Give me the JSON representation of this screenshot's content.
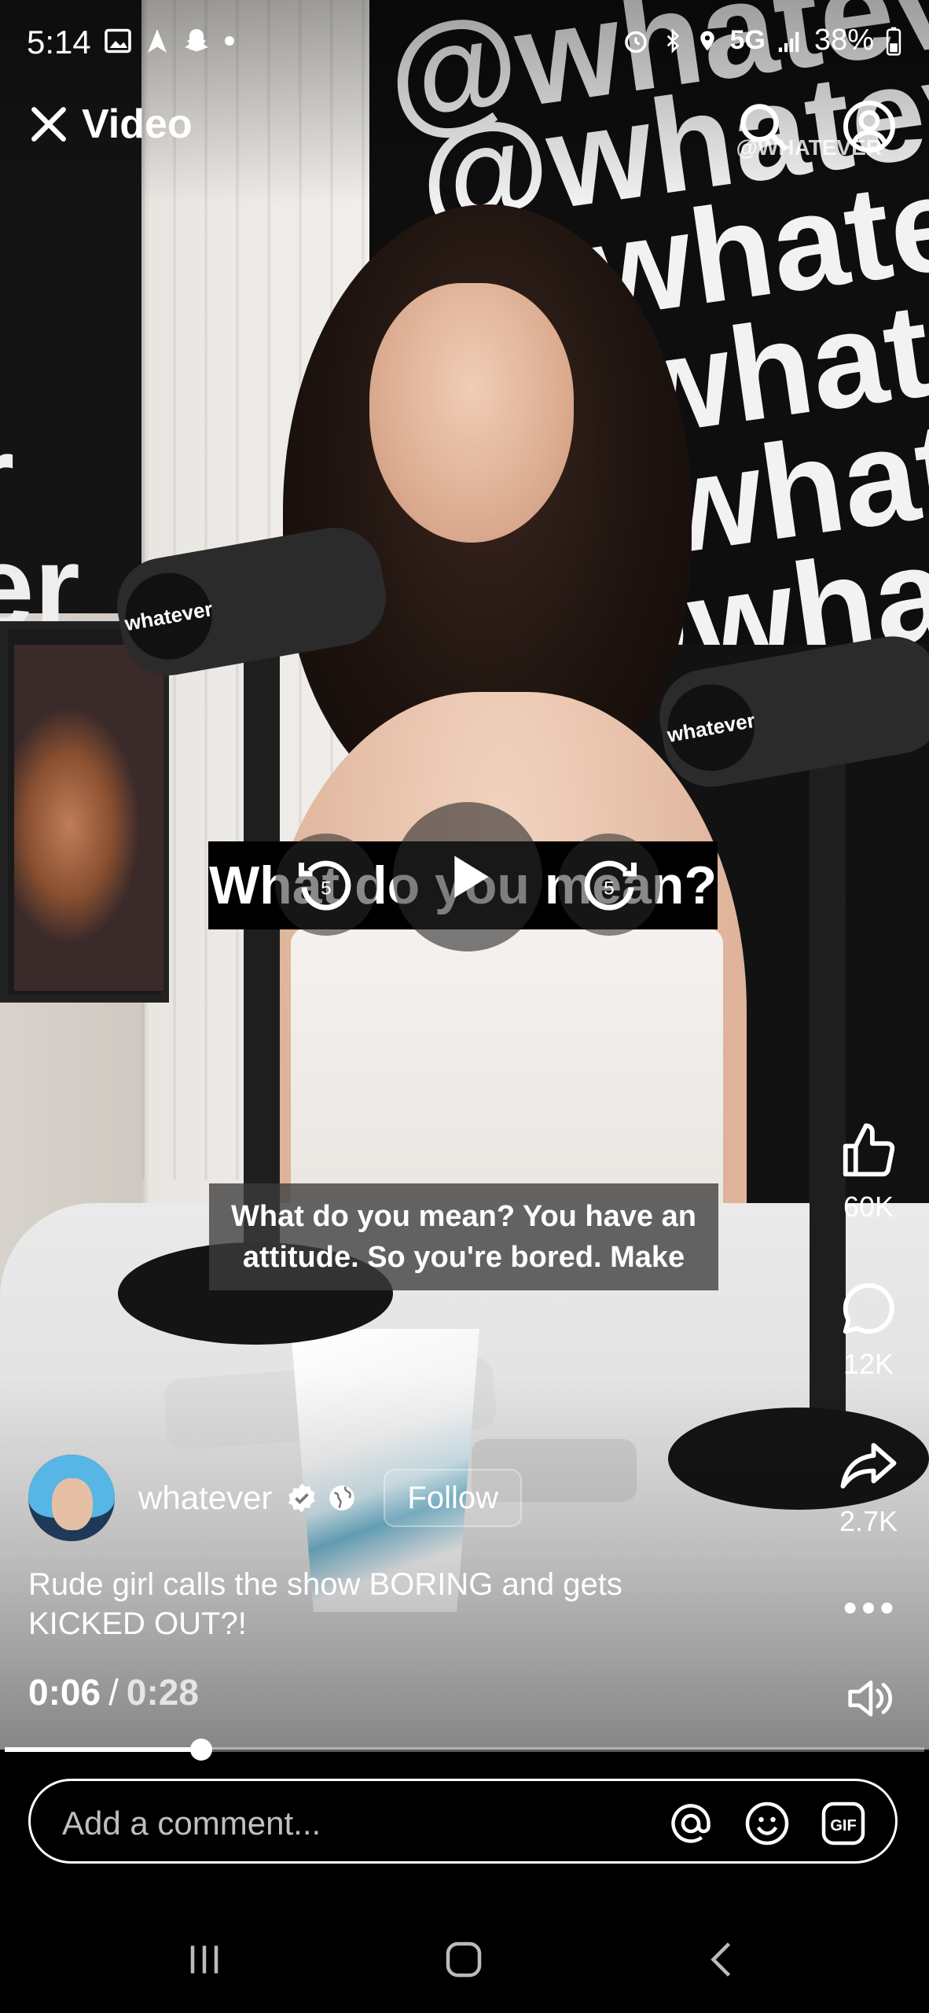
{
  "status_bar": {
    "time": "5:14",
    "network": "5G",
    "battery": "38%"
  },
  "header": {
    "close_label": "Video"
  },
  "video": {
    "watermark": "@WHATEVER",
    "banner_text": "@whatever",
    "mic_brand": "whatever",
    "caption_big": "What do you mean?",
    "caption_sub": "What do you mean? You have an attitude. So you're bored. Make",
    "skip_back_seconds": "5",
    "skip_forward_seconds": "5"
  },
  "actions": {
    "likes": "60K",
    "comments": "12K",
    "shares": "2.7K"
  },
  "author": {
    "name": "whatever",
    "follow_label": "Follow"
  },
  "description": "Rude girl calls the show BORING and gets KICKED OUT?!",
  "playback": {
    "current": "0:06",
    "separator": "/",
    "duration": "0:28",
    "progress_fraction": 0.214
  },
  "comment": {
    "placeholder": "Add a comment...",
    "gif_label": "GIF"
  },
  "colors": {
    "background": "#000000",
    "foreground": "#ffffff"
  },
  "icons": {
    "close": "close-icon",
    "search": "search-icon",
    "profile": "profile-icon",
    "like": "thumbs-up-icon",
    "comment": "comment-bubble-icon",
    "share": "share-arrow-icon",
    "more": "more-dots-icon",
    "volume": "volume-icon",
    "mention": "at-sign-icon",
    "emoji": "emoji-icon",
    "gif": "gif-icon"
  }
}
